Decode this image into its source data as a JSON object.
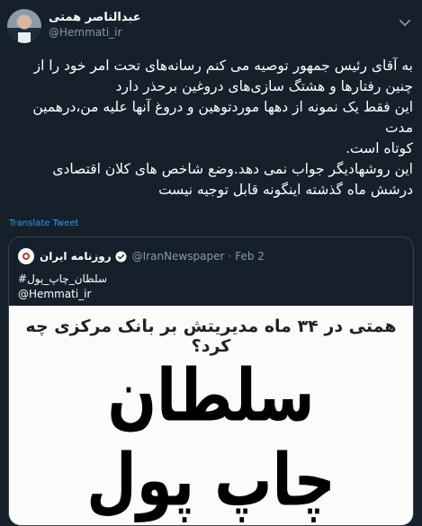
{
  "author": {
    "name": "عبدالناصر همتی",
    "handle": "@Hemmati_ir"
  },
  "tweet": {
    "text": "به آقای رئیس جمهور توصیه می کنم رسانه‌های تحت امر خود را از چنین رفتارها و هشتگ سازی‌های دروغین برحذر دارد\nاین فقط یک نمونه از دهها موردتوهین و دروغ آنها علیه من،درهمین مدت\nکوتاه است.\nاین روشهادیگر جواب نمی دهد.وضع شاخص های کلان اقتصادی درشش ماه گذشته اینگونه قابل توجیه نیست",
    "translate_label": "Translate Tweet"
  },
  "quoted": {
    "name": "روزنامه ایران",
    "handle": "@IranNewspaper",
    "date": "Feb 2",
    "separator": "·",
    "line1": "#سلطان_چاپ_پول",
    "line2": "@Hemmati_ir",
    "image_top": "همتی در ۳۴ ماه مدیریتش بر بانک مرکزی چه کرد؟",
    "image_big1": "سلطان",
    "image_big2": "چاپ پول"
  },
  "icons": {
    "caret": "chevron-down-icon",
    "verified": "verified-badge-icon"
  },
  "colors": {
    "background": "#15202b",
    "link": "#1da1f2",
    "muted": "#8899a6",
    "border": "#38444d"
  }
}
